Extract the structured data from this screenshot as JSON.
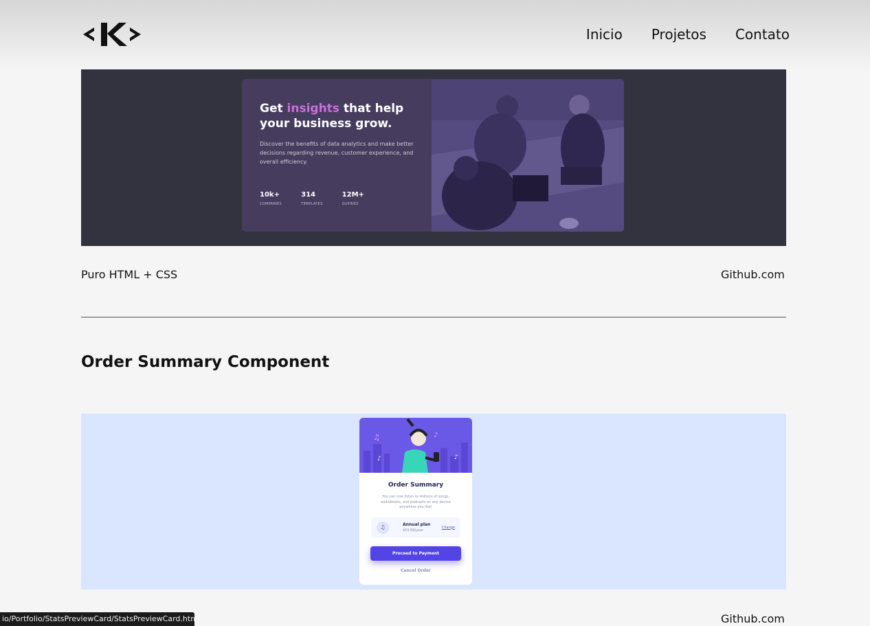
{
  "nav": {
    "items": [
      "Inicio",
      "Projetos",
      "Contato"
    ]
  },
  "project1": {
    "preview": {
      "title_pre": "Get ",
      "title_highlight": "insights",
      "title_post": " that help your business grow.",
      "description": "Discover the benefits of data analytics and make better decisions regarding revenue, customer experience, and overall efficiency.",
      "stats": [
        {
          "value": "10k+",
          "label": "COMPANIES"
        },
        {
          "value": "314",
          "label": "TEMPLATES"
        },
        {
          "value": "12M+",
          "label": "QUERIES"
        }
      ]
    },
    "tech": "Puro HTML + CSS",
    "link": "Github.com"
  },
  "project2": {
    "title": "Order Summary Component",
    "preview": {
      "card_title": "Order Summary",
      "description": "You can now listen to millions of songs, audiobooks, and podcasts on any device anywhere you like!",
      "plan_name": "Annual plan",
      "plan_price": "$59.99/year",
      "change_label": "Change",
      "pay_label": "Proceed to Payment",
      "cancel_label": "Cancel Order"
    },
    "link": "Github.com"
  },
  "status_bar": "io/Portfolio/StatsPreviewCard/StatsPreviewCard.html",
  "colors": {
    "accent": "#c86fd9",
    "button": "#5244e6",
    "page_bg": "#f5f5f5"
  },
  "icons": [
    "logo-k-icon",
    "music-note-icon"
  ]
}
